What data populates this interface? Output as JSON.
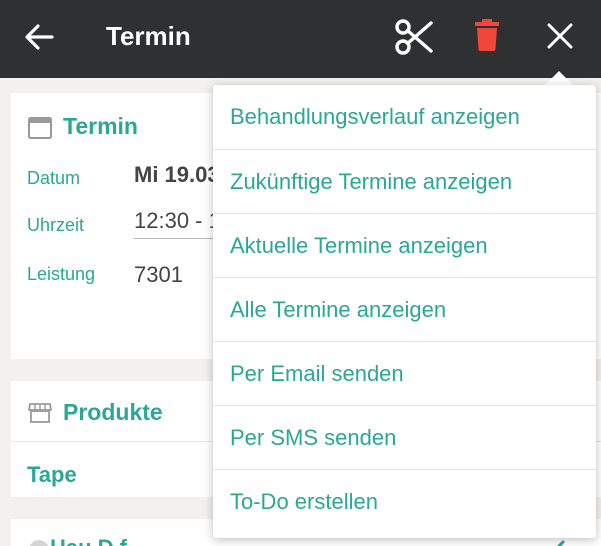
{
  "header": {
    "title": "Termin",
    "icons": [
      "arrow-left-icon",
      "scissors-icon",
      "trash-icon",
      "close-icon"
    ],
    "colors": {
      "background": "#2e3032",
      "delete": "#f0473b",
      "foreground": "#ffffff"
    }
  },
  "termin_card": {
    "title": "Termin",
    "rows": [
      {
        "label": "Datum",
        "value": "Mi 19.03"
      },
      {
        "label": "Uhrzeit",
        "value": "12:30 - 1"
      },
      {
        "label": "Leistung",
        "value": "7301"
      }
    ]
  },
  "produkte_card": {
    "title": "Produkte",
    "item": "Tape"
  },
  "third_card": {
    "title_partial": "Hau  D    f"
  },
  "menu": {
    "items": [
      "Behandlungsverlauf anzeigen",
      "Zukünftige Termine anzeigen",
      "Aktuelle Termine anzeigen",
      "Alle Termine anzeigen",
      "Per Email senden",
      "Per SMS senden",
      "To-Do erstellen"
    ]
  },
  "colors": {
    "accent": "#2aa796",
    "page_background": "#f3f1ef"
  }
}
